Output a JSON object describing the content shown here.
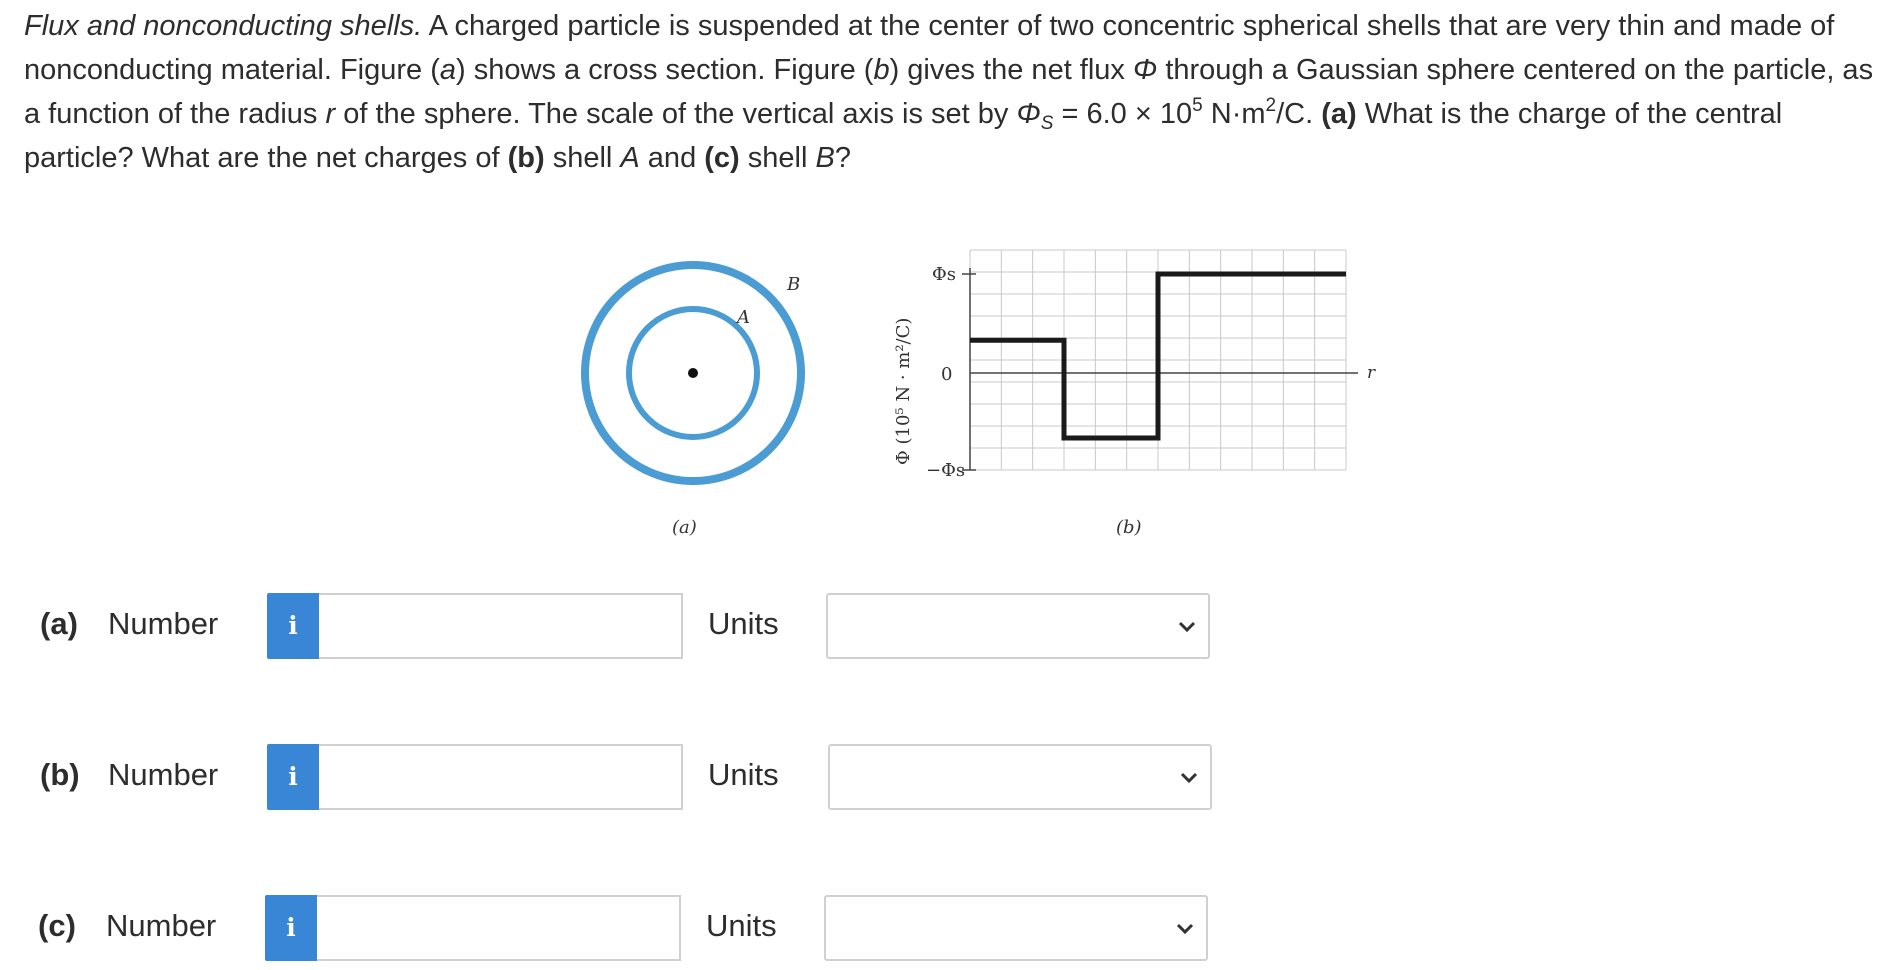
{
  "question": {
    "title": "Flux and nonconducting shells.",
    "s1": " A charged particle is suspended at the center of two concentric spherical shells that are very thin and made of nonconducting material. Figure (",
    "fig_a": "a",
    "s2": ") shows a cross section. Figure (",
    "fig_b": "b",
    "s3": ") gives the net flux ",
    "phi": "Φ",
    "s4": " through a Gaussian sphere centered on the particle, as a function of the radius ",
    "r": "r",
    "s5": " of the sphere. The scale of the vertical axis is set by ",
    "phi_s": "Φ",
    "sub_s": "S",
    "s6": " = 6.0 × 10",
    "exp5": "5",
    "s7": " N·m",
    "exp2": "2",
    "s8": "/C. ",
    "pa": "(a)",
    "s9": " What is the charge of the central particle? What are the net charges of ",
    "pb": "(b)",
    "s10": " shell ",
    "shellA": "A",
    "s11": " and ",
    "pc": "(c)",
    "s12": " shell ",
    "shellB": "B",
    "s13": "?"
  },
  "figure_a": {
    "label_a": "A",
    "label_b": "B",
    "caption": "(a)",
    "shell_color": "#4b9cd3"
  },
  "figure_b": {
    "y_axis_label": "Φ (10⁵ N · m²/C)",
    "tick_top": "Φs",
    "tick_zero": "0",
    "tick_bottom": "−Φs",
    "x_axis_label": "r",
    "caption": "(b)"
  },
  "chart_data": {
    "type": "line",
    "title": "",
    "xlabel": "r",
    "ylabel": "Φ (10⁵ N · m²/C)",
    "y_ticks": [
      "−Φs",
      "0",
      "Φs"
    ],
    "ylim": [
      -1,
      1
    ],
    "xlim": [
      0,
      12
    ],
    "grid": true,
    "series": [
      {
        "x": [
          0,
          3,
          3,
          6,
          6,
          12
        ],
        "y": [
          0.33,
          0.33,
          -0.67,
          -0.67,
          1,
          1
        ]
      }
    ]
  },
  "answers": [
    {
      "part": "(a)",
      "number_label": "Number",
      "info_icon": "i",
      "value": "",
      "units_label": "Units",
      "units_value": ""
    },
    {
      "part": "(b)",
      "number_label": "Number",
      "info_icon": "i",
      "value": "",
      "units_label": "Units",
      "units_value": ""
    },
    {
      "part": "(c)",
      "number_label": "Number",
      "info_icon": "i",
      "value": "",
      "units_label": "Units",
      "units_value": ""
    }
  ],
  "colors": {
    "info_button": "#3a86d6",
    "border": "#d0d0d0",
    "text": "#2d2d2d"
  }
}
